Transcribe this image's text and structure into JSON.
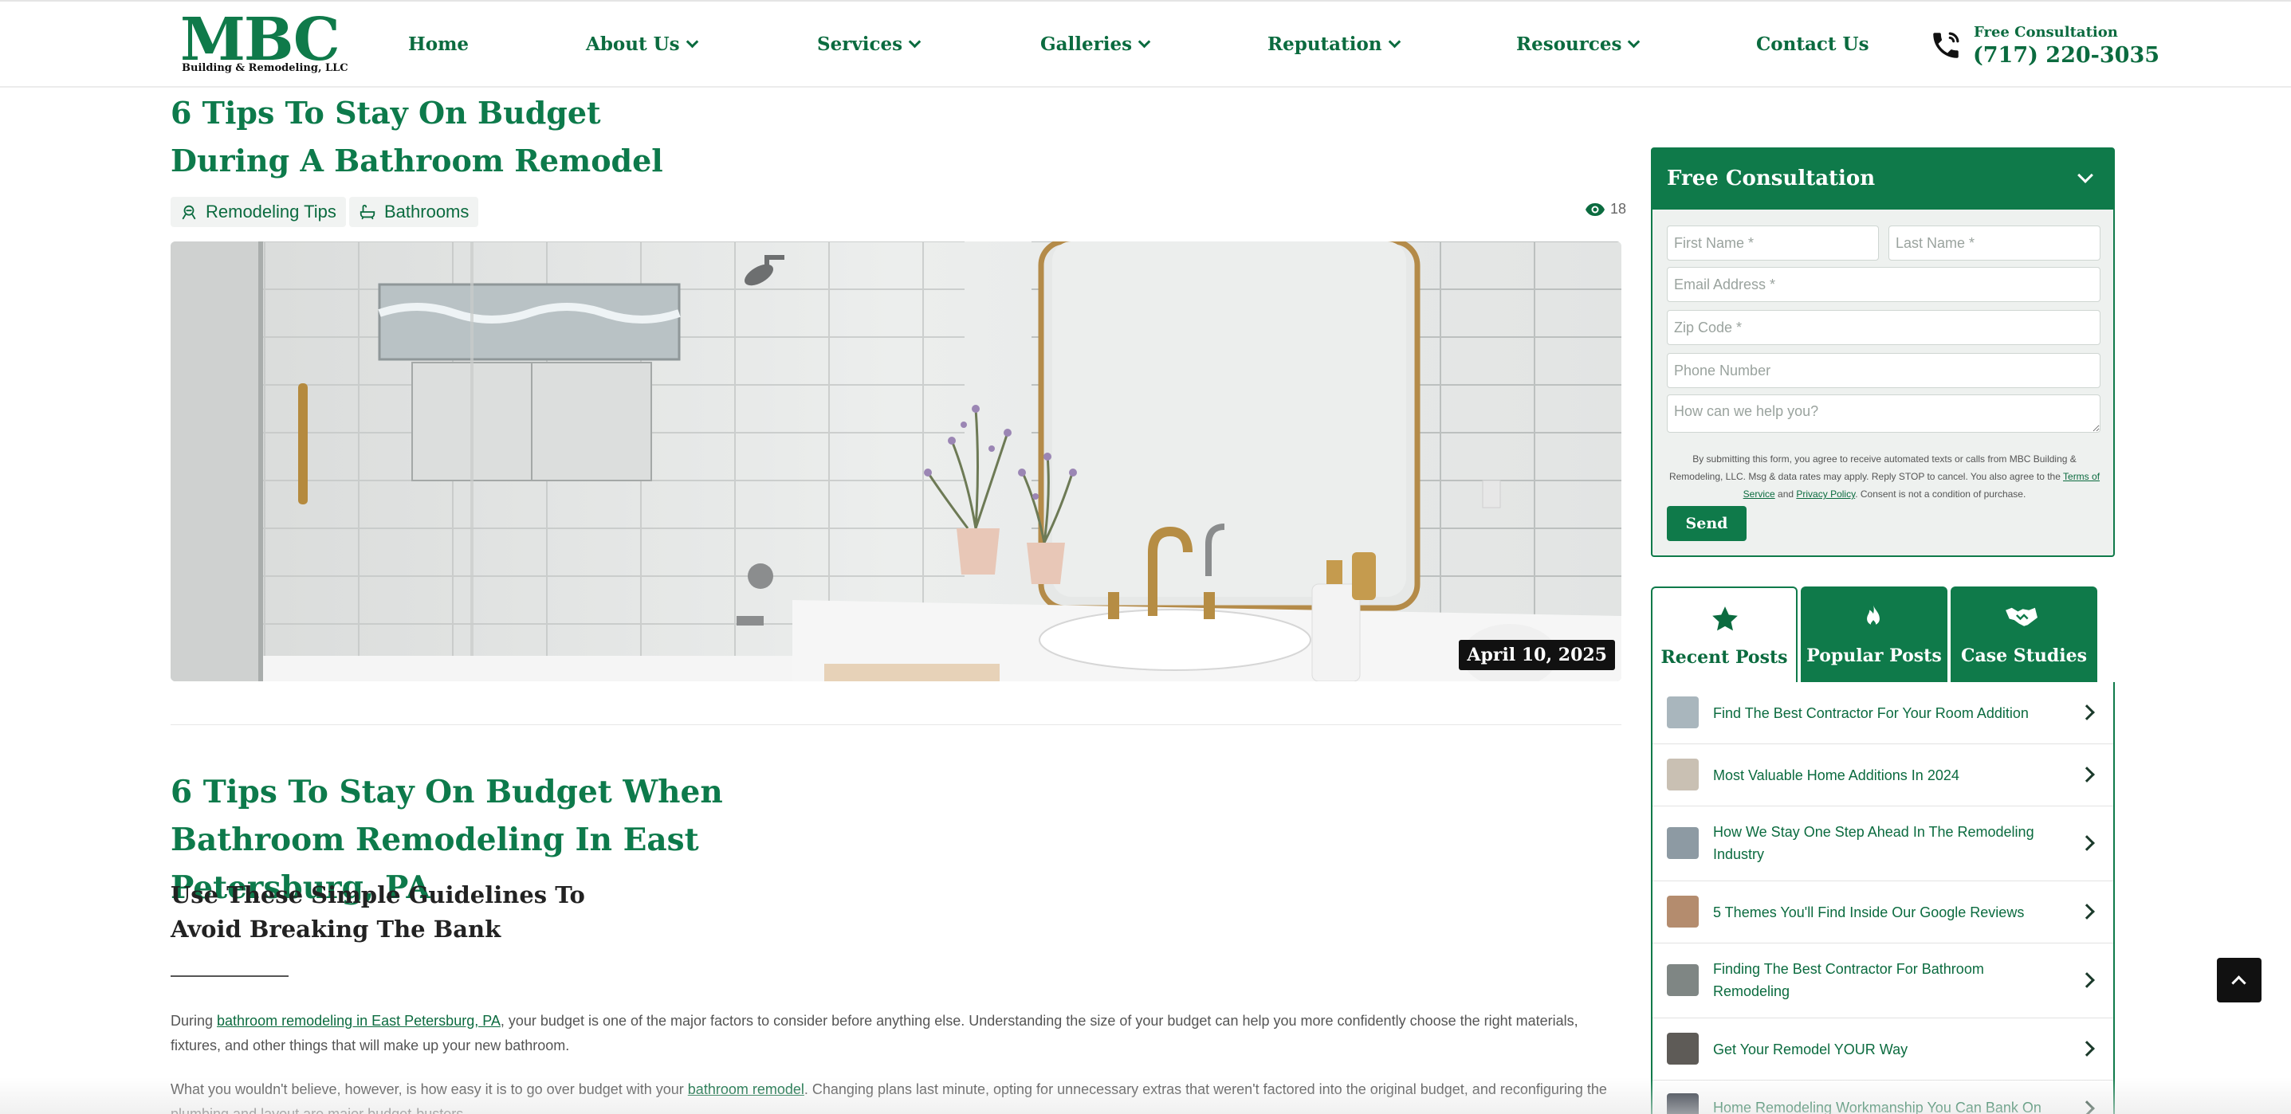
{
  "brand": {
    "logo_text": "MBC",
    "logo_subtitle": "Building & Remodeling, LLC",
    "primary_color": "#0f7a4a"
  },
  "nav": {
    "items": [
      {
        "label": "Home",
        "has_dropdown": false
      },
      {
        "label": "About Us",
        "has_dropdown": true
      },
      {
        "label": "Services",
        "has_dropdown": true
      },
      {
        "label": "Galleries",
        "has_dropdown": true
      },
      {
        "label": "Reputation",
        "has_dropdown": true
      },
      {
        "label": "Resources",
        "has_dropdown": true
      },
      {
        "label": "Contact Us",
        "has_dropdown": false
      }
    ],
    "phone_caption": "Free Consultation",
    "phone_number": "(717) 220-3035",
    "phone_icon": "phone-icon"
  },
  "post": {
    "title": "6 Tips To Stay On Budget During A Bathroom Remodel",
    "tags": [
      {
        "label": "Remodeling Tips",
        "icon": "tips-icon"
      },
      {
        "label": "Bathrooms",
        "icon": "bathtub-icon"
      }
    ],
    "views": "18",
    "date": "April 10, 2025",
    "heading": "6 Tips To Stay On Budget When Bathroom Remodeling In East Petersburg, PA",
    "subheading": "Use These Simple Guidelines To Avoid Breaking The Bank",
    "p1_before": "During ",
    "p1_link": "bathroom remodeling in East Petersburg, PA",
    "p1_after": ", your budget is one of the major factors to consider before anything else. Understanding the size of your budget can help you more confidently choose the right materials, fixtures, and other things that will make up your new bathroom.",
    "p2_before": "What you wouldn't believe, however, is how easy it is to go over budget with your ",
    "p2_link": "bathroom remodel",
    "p2_after": ". Changing plans last minute, opting for unnecessary extras that weren't factored into the original budget, and reconfiguring the plumbing and layout are major budget-busters."
  },
  "form": {
    "title": "Free Consultation",
    "first_name_placeholder": "First Name *",
    "last_name_placeholder": "Last Name *",
    "email_placeholder": "Email Address *",
    "zip_placeholder": "Zip Code *",
    "phone_placeholder": "Phone Number",
    "message_placeholder": "How can we help you?",
    "disclaimer_before": "By submitting this form, you agree to receive automated texts or calls from MBC Building & Remodeling, LLC. Msg & data rates may apply. Reply STOP to cancel. You also agree to the ",
    "terms_link": "Terms of Service",
    "disclaimer_and": " and ",
    "privacy_link": "Privacy Policy",
    "disclaimer_after": ". Consent is not a condition of purchase.",
    "send_label": "Send"
  },
  "tabs": [
    {
      "label": "Recent Posts",
      "icon": "star-icon",
      "active": true
    },
    {
      "label": "Popular Posts",
      "icon": "flame-icon",
      "active": false
    },
    {
      "label": "Case Studies",
      "icon": "handshake-icon",
      "active": false
    }
  ],
  "recent_posts": [
    "Find The Best Contractor For Your Room Addition",
    "Most Valuable Home Additions In 2024",
    "How We Stay One Step Ahead In The Remodeling Industry",
    "5 Themes You'll Find Inside Our Google Reviews",
    "Finding The Best Contractor For Bathroom Remodeling",
    "Get Your Remodel YOUR Way",
    "Home Remodeling Workmanship You Can Bank On"
  ]
}
